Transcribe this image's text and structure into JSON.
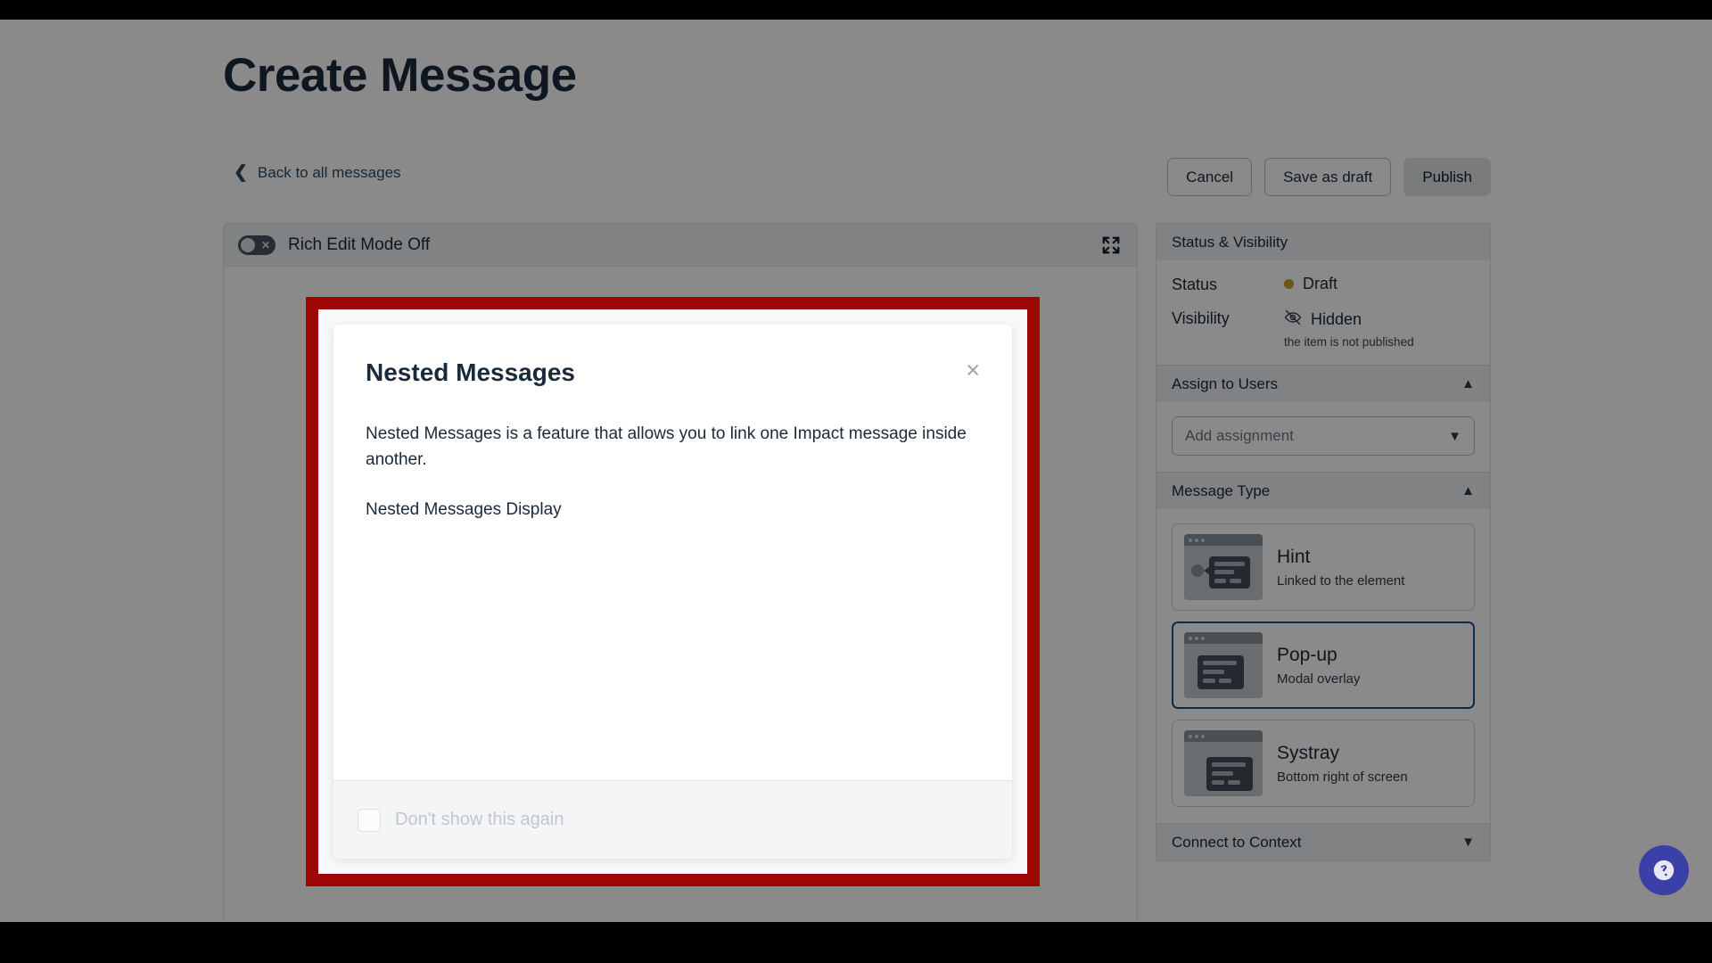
{
  "page": {
    "title": "Create Message",
    "back_link": "Back to all messages"
  },
  "toolbar": {
    "cancel": "Cancel",
    "save_draft": "Save as draft",
    "publish": "Publish"
  },
  "editor": {
    "rich_edit_label": "Rich Edit Mode Off",
    "toggle_state": "off",
    "fullscreen_icon": "fullscreen-icon"
  },
  "sidebar": {
    "status_visibility": {
      "heading": "Status & Visibility",
      "status_key": "Status",
      "status_value": "Draft",
      "status_color": "#c9a227",
      "visibility_key": "Visibility",
      "visibility_value": "Hidden",
      "visibility_note": "the item is not published"
    },
    "assign": {
      "heading": "Assign to Users",
      "select_placeholder": "Add assignment"
    },
    "message_type": {
      "heading": "Message Type",
      "options": [
        {
          "title": "Hint",
          "subtitle": "Linked to the element",
          "selected": false
        },
        {
          "title": "Pop-up",
          "subtitle": "Modal overlay",
          "selected": true
        },
        {
          "title": "Systray",
          "subtitle": "Bottom right of screen",
          "selected": false
        }
      ]
    },
    "connect_context": {
      "heading": "Connect to Context"
    }
  },
  "modal": {
    "title": "Nested Messages",
    "close_label": "×",
    "paragraphs": [
      "Nested Messages is a feature that allows you to link one Impact message inside another.",
      "Nested Messages Display"
    ],
    "footer_checkbox_label": "Don't show this again",
    "checkbox_checked": false
  },
  "highlight": {
    "border_color": "#9e0505"
  },
  "help_button": {
    "icon": "help-chat-icon",
    "color": "#3b3fa8"
  }
}
